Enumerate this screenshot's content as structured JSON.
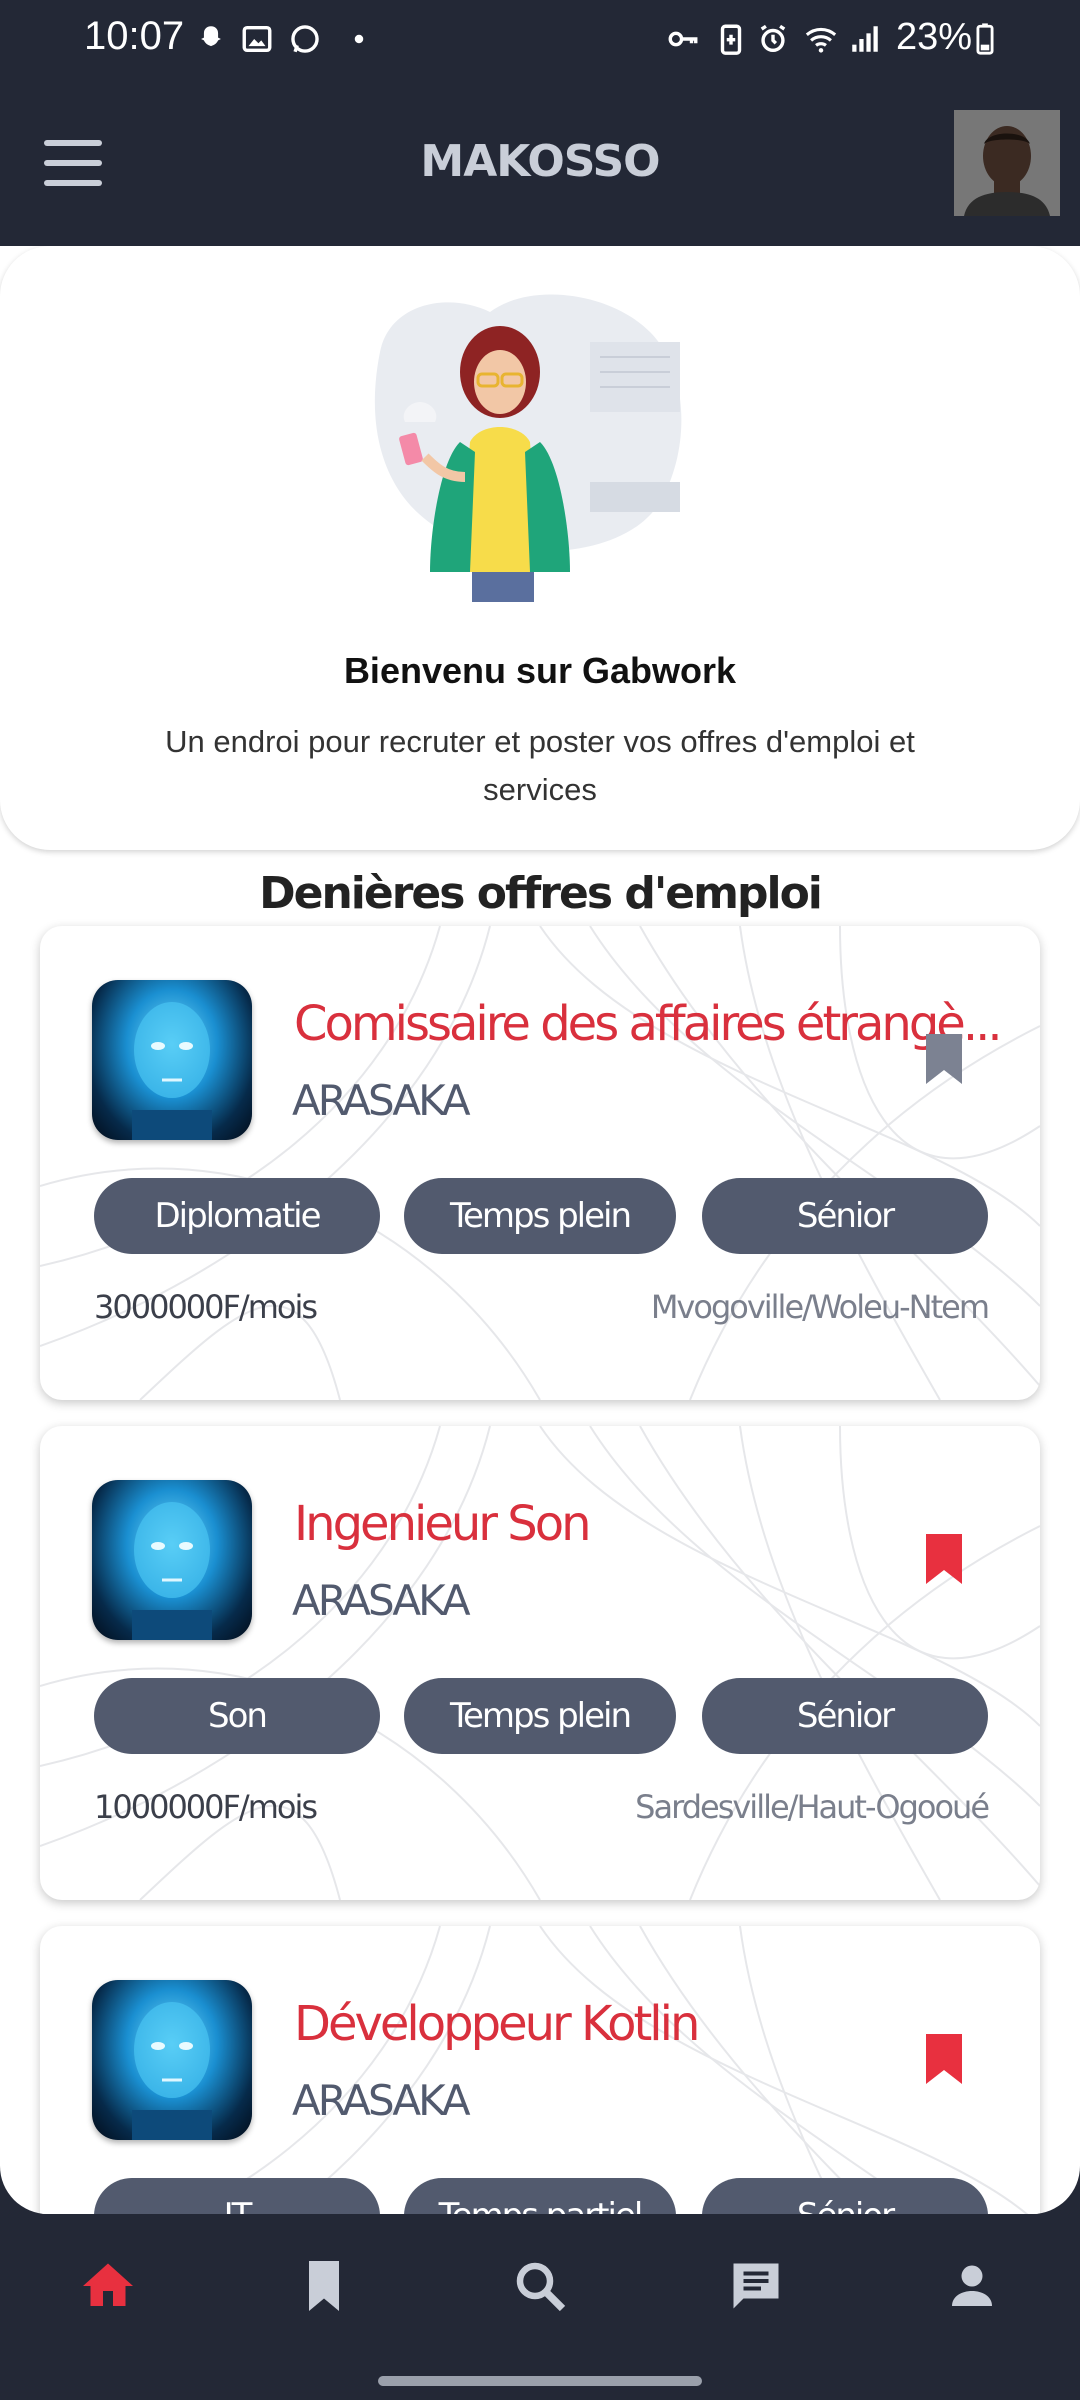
{
  "status_bar": {
    "time": "10:07",
    "battery": "23%",
    "icons": [
      "snapchat-icon",
      "gallery-icon",
      "whatsapp-icon",
      "dot-icon",
      "key-icon",
      "battery-saver-icon",
      "alarm-icon",
      "wifi-icon",
      "signal-icon",
      "battery-icon"
    ]
  },
  "app_bar": {
    "title": "MAKOSSO",
    "menu_icon": "hamburger-menu-icon",
    "avatar": "profile-photo"
  },
  "welcome": {
    "title": "Bienvenu sur Gabwork",
    "subtitle": "Un endroi pour recruter et poster vos offres d'emploi et services"
  },
  "section": {
    "title": "Denières offres d'emploi"
  },
  "jobs": [
    {
      "title": "Comissaire des affaires étrangè...",
      "company": "ARASAKA",
      "tags": [
        "Diplomatie",
        "Temps plein",
        "Sénior"
      ],
      "salary": "3000000F/mois",
      "location": "Mvogoville/Woleu-Ntem",
      "bookmarked": false
    },
    {
      "title": "Ingenieur Son",
      "company": "ARASAKA",
      "tags": [
        "Son",
        "Temps plein",
        "Sénior"
      ],
      "salary": "1000000F/mois",
      "location": "Sardesville/Haut-Ogooué",
      "bookmarked": true
    },
    {
      "title": "Développeur Kotlin",
      "company": "ARASAKA",
      "tags": [
        "IT",
        "Temps partiel",
        "Sénior"
      ],
      "salary": "",
      "location": "",
      "bookmarked": true
    }
  ],
  "bottom_nav": {
    "items": [
      "home-icon",
      "bookmark-icon",
      "search-icon",
      "chat-icon",
      "profile-icon"
    ],
    "active": "home-icon"
  },
  "colors": {
    "background": "#232836",
    "accent": "#d9303d",
    "tag": "#525a6e",
    "bookmark_inactive": "#7c8292"
  }
}
